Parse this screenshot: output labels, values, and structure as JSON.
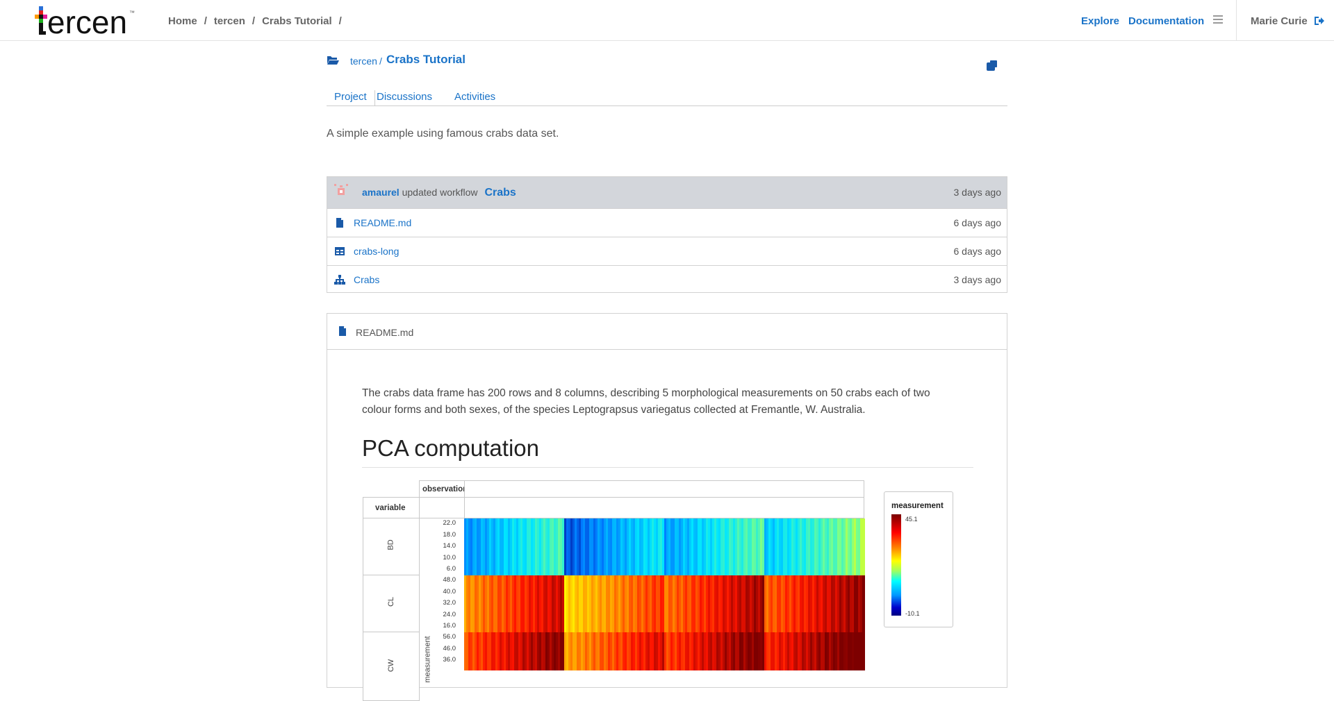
{
  "navbar": {
    "logo_text": "ercen",
    "logo_tm": "™",
    "breadcrumbs": [
      "Home",
      "tercen",
      "Crabs Tutorial"
    ],
    "explore": "Explore",
    "documentation": "Documentation",
    "user": "Marie Curie"
  },
  "project": {
    "owner": "tercen",
    "slash": "/",
    "title": "Crabs Tutorial",
    "tabs": [
      "Project",
      "Discussions",
      "Activities"
    ],
    "description": "A simple example using famous crabs data set."
  },
  "activity": {
    "header": {
      "user": "amaurel",
      "action": "updated workflow",
      "target": "Crabs",
      "time": "3 days ago"
    },
    "rows": [
      {
        "icon": "file-icon",
        "label": "README.md",
        "time": "6 days ago"
      },
      {
        "icon": "table-icon",
        "label": "crabs-long",
        "time": "6 days ago"
      },
      {
        "icon": "workflow-icon",
        "label": "Crabs",
        "time": "3 days ago"
      }
    ]
  },
  "readme": {
    "title": "README.md",
    "body": "The crabs data frame has 200 rows and 8 columns, describing 5 morphological measurements on 50 crabs each of two colour forms and both sexes, of the species Leptograpsus variegatus collected at Fremantle, W. Australia.",
    "heading": "PCA computation"
  },
  "figure": {
    "col_header": "observation",
    "row_header": "variable",
    "y_axis_label": "measurement",
    "legend_title": "measurement",
    "legend_max": "45.1",
    "legend_min": "-10.1",
    "facets": [
      {
        "name": "BD",
        "ticks": [
          "22.0",
          "18.0",
          "14.0",
          "10.0",
          "6.0"
        ],
        "level": [
          0.3,
          0.22,
          0.32,
          0.38
        ]
      },
      {
        "name": "CL",
        "ticks": [
          "48.0",
          "40.0",
          "32.0",
          "24.0",
          "16.0"
        ],
        "level": [
          0.82,
          0.72,
          0.86,
          0.88
        ]
      },
      {
        "name": "CW",
        "ticks": [
          "56.0",
          "46.0",
          "36.0"
        ],
        "level": [
          0.9,
          0.8,
          0.92,
          0.95
        ]
      }
    ]
  },
  "colors": {
    "accent": "#1a73c8",
    "activity_header": "#d3d6db"
  }
}
